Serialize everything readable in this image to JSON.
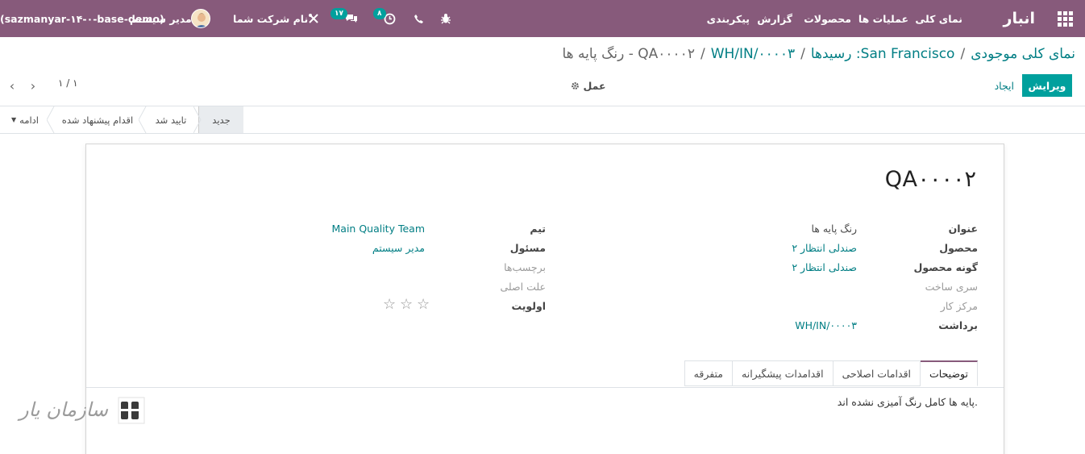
{
  "navbar": {
    "brand": "انبار",
    "menu": [
      "نمای کلی",
      "عملیات ها",
      "محصولات",
      "گزارش",
      "پیکربندی"
    ],
    "activity_count": "۸",
    "messages_count": "۱۷",
    "company": "نام شرکت شما",
    "user": "مدیر سیستم",
    "database": "(sazmanyar-۱۴-۰-base-demo)"
  },
  "breadcrumb": {
    "items": [
      "نمای کلی موجودی",
      "San Francisco: رسیدها",
      "WH/IN/۰۰۰۰۳"
    ],
    "current": "QA۰۰۰۰۲ - رنگ پایه ها"
  },
  "actions": {
    "edit": "ویرایش",
    "create": "ایجاد",
    "action": "عمل",
    "pager": "۱ / ۱"
  },
  "statusbar": {
    "stages": [
      "جدید",
      "تایید شد",
      "اقدام پیشنهاد شده"
    ],
    "current_stage": "جدید",
    "more": "ادامه"
  },
  "record": {
    "name": "QA۰۰۰۰۲",
    "left": [
      {
        "label": "عنوان",
        "value": "رنگ پایه ها"
      },
      {
        "label": "محصول",
        "value": "صندلی انتظار ۲"
      },
      {
        "label": "گونه محصول",
        "value": "صندلی انتظار ۲"
      },
      {
        "label": "سری ساخت",
        "value": ""
      },
      {
        "label": "مرکز کار",
        "value": ""
      },
      {
        "label": "برداشت",
        "value": "WH/IN/۰۰۰۰۳"
      }
    ],
    "right": [
      {
        "label": "تیم",
        "value": "Main Quality Team"
      },
      {
        "label": "مسئول",
        "value": "مدیر سیستم"
      },
      {
        "label": "برچسب‌ها",
        "value": ""
      },
      {
        "label": "علت اصلی",
        "value": ""
      },
      {
        "label": "اولویت",
        "value": ""
      }
    ],
    "priority_stars": 0
  },
  "tabs": [
    "توضیحات",
    "اقدامات اصلاحی",
    "اقدامدات پیشگیرانه",
    "متفرقه"
  ],
  "active_tab": "توضیحات",
  "tab_content": "پایه ها کامل رنگ آمیزی نشده اند.",
  "watermark": {
    "text": "سازمان یار"
  },
  "colors": {
    "brand": "#875a7b",
    "accent": "#00a09d",
    "link": "#017e84"
  }
}
